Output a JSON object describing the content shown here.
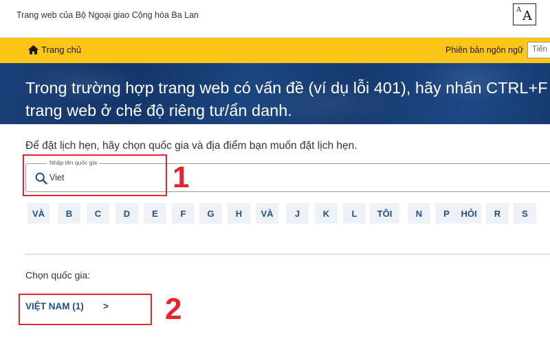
{
  "header": {
    "site_title": "Trang web của Bộ Ngoại giao Cộng hòa Ba Lan",
    "font_size_small": "A",
    "font_size_large": "A",
    "font_size_icon": "font-size-icon"
  },
  "nav": {
    "home_label": "Trang chủ",
    "home_icon": "home-icon",
    "language_label": "Phiên bản ngôn ngữ",
    "language_value": "Tiến"
  },
  "banner": {
    "line1": "Trong trường hợp trang web có vấn đề (ví dụ lỗi 401), hãy nhấn CTRL+F",
    "line2": "trang web ở chế độ riêng tư/ẩn danh."
  },
  "main": {
    "instruction": "Để đặt lịch hẹn, hãy chọn quốc gia và địa điểm bạn muốn đặt lịch hẹn.",
    "search": {
      "legend": "Nhập tên quốc gia",
      "value": "Viet",
      "icon": "search-icon"
    },
    "letters": [
      "VÀ",
      "B",
      "C",
      "D",
      "E",
      "F",
      "G",
      "H",
      "VÀ",
      "J",
      "K",
      "L",
      "TÔI",
      "N",
      "P",
      "HỎI",
      "R",
      "S"
    ],
    "choose_label": "Chọn quốc gia:",
    "country": {
      "name": "VIỆT NAM (1)",
      "arrow": ">"
    }
  },
  "annotations": {
    "marker1": "1",
    "marker2": "2",
    "color": "#e3262d"
  },
  "colors": {
    "nav_bg": "#fcc619",
    "banner_bg": "#1b3f78",
    "link": "#1f4e8c",
    "letter_bg": "#eef1f6"
  }
}
